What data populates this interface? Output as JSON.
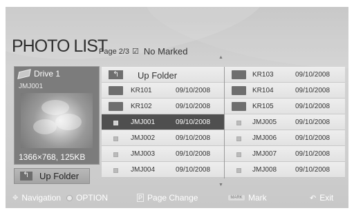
{
  "title": "PHOTO LIST",
  "page_indicator": "Page 2/3",
  "marked_status": "No Marked",
  "preview": {
    "drive_label": "Drive 1",
    "file_name": "JMJ001",
    "resolution_size": "1366×768, 125KB"
  },
  "up_folder_button": "Up Folder",
  "grid": {
    "up_folder_label": "Up Folder",
    "left": [
      {
        "name": "KR101",
        "date": "09/10/2008",
        "type": "folder"
      },
      {
        "name": "KR102",
        "date": "09/10/2008",
        "type": "folder"
      },
      {
        "name": "JMJ001",
        "date": "09/10/2008",
        "type": "file"
      },
      {
        "name": "JMJ002",
        "date": "09/10/2008",
        "type": "file"
      },
      {
        "name": "JMJ003",
        "date": "09/10/2008",
        "type": "file"
      },
      {
        "name": "JMJ004",
        "date": "09/10/2008",
        "type": "file"
      }
    ],
    "right": [
      {
        "name": "KR103",
        "date": "09/10/2008",
        "type": "folder"
      },
      {
        "name": "KR104",
        "date": "09/10/2008",
        "type": "folder"
      },
      {
        "name": "KR105",
        "date": "09/10/2008",
        "type": "folder"
      },
      {
        "name": "JMJ005",
        "date": "09/10/2008",
        "type": "file"
      },
      {
        "name": "JMJ006",
        "date": "09/10/2008",
        "type": "file"
      },
      {
        "name": "JMJ007",
        "date": "09/10/2008",
        "type": "file"
      },
      {
        "name": "JMJ008",
        "date": "09/10/2008",
        "type": "file"
      }
    ],
    "selected": "JMJ001"
  },
  "footer": {
    "navigation": "Navigation",
    "option": "OPTION",
    "page_change": "Page Change",
    "mark": "Mark",
    "mark_key": "MARK",
    "exit": "Exit"
  },
  "colors": {
    "selected_row": "#4f4f4f",
    "panel_bg": "#cfcfcf"
  }
}
